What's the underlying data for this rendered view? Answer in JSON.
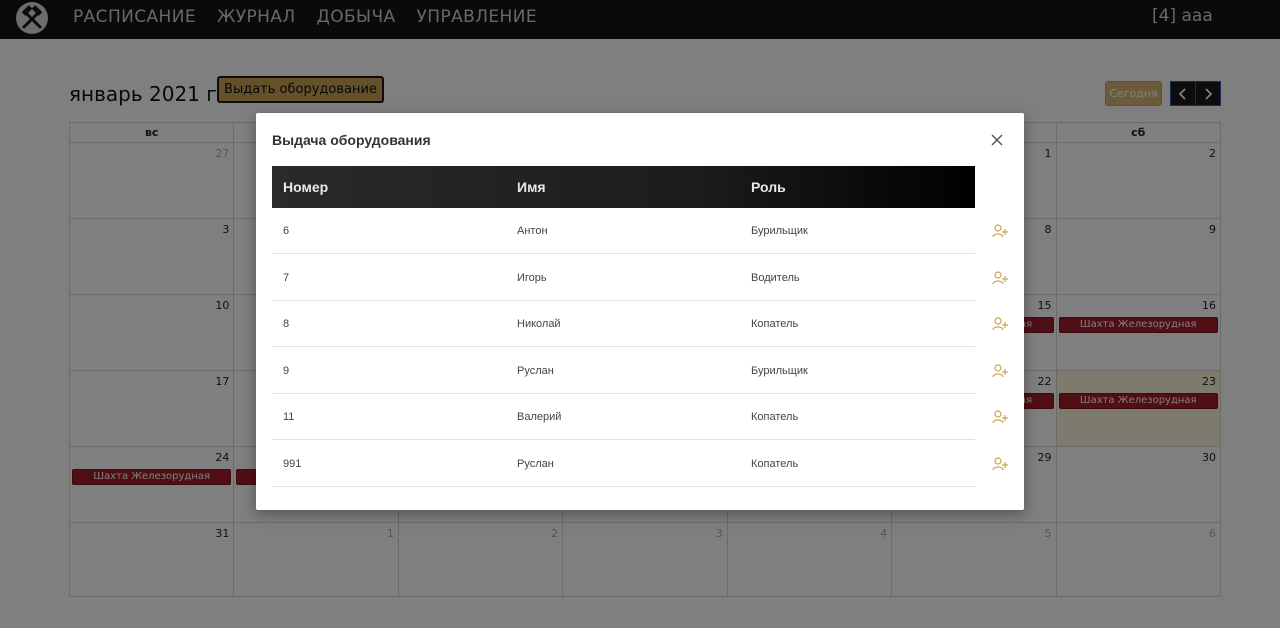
{
  "nav": {
    "items": [
      "РАСПИСАНИЕ",
      "ЖУРНАЛ",
      "ДОБЫЧА",
      "УПРАВЛЕНИЕ"
    ],
    "user": "[4] aaa"
  },
  "calendar": {
    "title": "январь 2021 г.",
    "issue_button": "Выдать оборудование",
    "today_button": "Сегодня",
    "dow": [
      "вс",
      "",
      "",
      "",
      "",
      "",
      "сб"
    ],
    "weeks": [
      [
        {
          "n": "27",
          "other": true
        },
        {
          "n": "",
          "other": true
        },
        {
          "n": "",
          "other": true
        },
        {
          "n": "",
          "other": true
        },
        {
          "n": "",
          "other": true
        },
        {
          "n": "1"
        },
        {
          "n": "2"
        }
      ],
      [
        {
          "n": "3"
        },
        {
          "n": ""
        },
        {
          "n": ""
        },
        {
          "n": ""
        },
        {
          "n": ""
        },
        {
          "n": "8"
        },
        {
          "n": "9"
        }
      ],
      [
        {
          "n": "10"
        },
        {
          "n": ""
        },
        {
          "n": ""
        },
        {
          "n": ""
        },
        {
          "n": ""
        },
        {
          "n": "15",
          "event": "Шахта Железорудная"
        },
        {
          "n": "16",
          "event": "Шахта Железорудная"
        }
      ],
      [
        {
          "n": "17"
        },
        {
          "n": ""
        },
        {
          "n": ""
        },
        {
          "n": ""
        },
        {
          "n": ""
        },
        {
          "n": "22",
          "event": "Шахта Железорудная"
        },
        {
          "n": "23",
          "event": "Шахта Железорудная",
          "today": true
        }
      ],
      [
        {
          "n": "24",
          "event": "Шахта Железорудная"
        },
        {
          "n": "",
          "event": "Шахта Железорудная"
        },
        {
          "n": ""
        },
        {
          "n": ""
        },
        {
          "n": ""
        },
        {
          "n": "29"
        },
        {
          "n": "30"
        }
      ],
      [
        {
          "n": "31"
        },
        {
          "n": "1",
          "other": true
        },
        {
          "n": "2",
          "other": true
        },
        {
          "n": "3",
          "other": true
        },
        {
          "n": "4",
          "other": true
        },
        {
          "n": "5",
          "other": true
        },
        {
          "n": "6",
          "other": true
        }
      ]
    ]
  },
  "modal": {
    "title": "Выдача оборудования",
    "columns": [
      "Номер",
      "Имя",
      "Роль"
    ],
    "rows": [
      {
        "number": "6",
        "name": "Антон",
        "role": "Бурильщик"
      },
      {
        "number": "7",
        "name": "Игорь",
        "role": "Водитель"
      },
      {
        "number": "8",
        "name": "Николай",
        "role": "Копатель"
      },
      {
        "number": "9",
        "name": "Руслан",
        "role": "Бурильщик"
      },
      {
        "number": "11",
        "name": "Валерий",
        "role": "Копатель"
      },
      {
        "number": "991",
        "name": "Руслан",
        "role": "Копатель"
      }
    ]
  },
  "colors": {
    "accent": "#c9a253",
    "event": "#a11d2b",
    "topbar": "#141414"
  }
}
